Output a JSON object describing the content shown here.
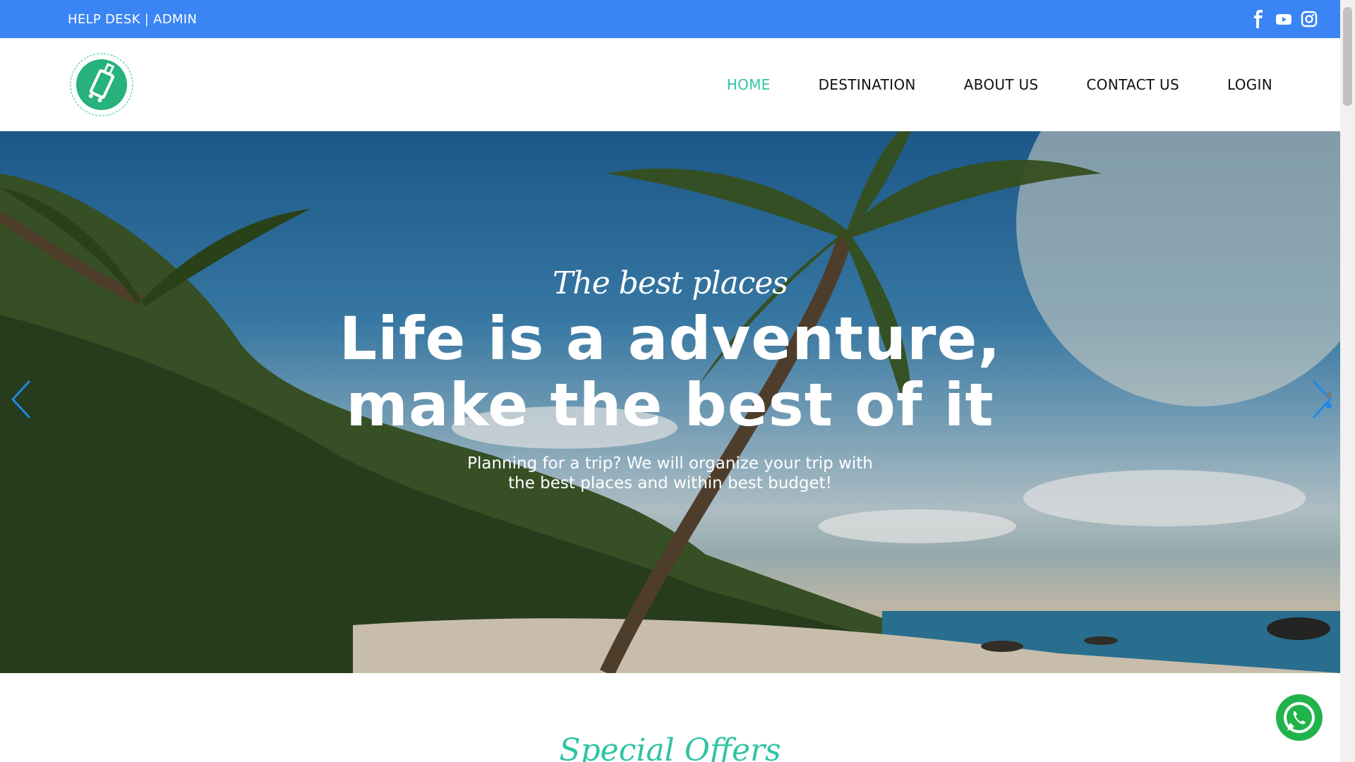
{
  "topbar": {
    "help_desk": "HELP DESK",
    "separator": "|",
    "admin": "ADMIN",
    "social_icons": [
      "facebook-icon",
      "youtube-icon",
      "instagram-icon"
    ]
  },
  "nav": {
    "items": [
      {
        "label": "HOME",
        "active": true
      },
      {
        "label": "DESTINATION",
        "active": false
      },
      {
        "label": "ABOUT US",
        "active": false
      },
      {
        "label": "CONTACT US",
        "active": false
      },
      {
        "label": "LOGIN",
        "active": false
      }
    ]
  },
  "hero": {
    "kicker": "The best places",
    "headline_line1": "Life is a adventure,",
    "headline_line2": "make the best of it",
    "sub_line1": "Planning for a trip? We will organize your trip with",
    "sub_line2": "the best places and within best budget!",
    "slide_count": 2,
    "active_slide": 2
  },
  "section": {
    "title": "Special Offers"
  },
  "colors": {
    "topbar": "#3b84f4",
    "accent": "#2ec4a5",
    "whatsapp": "#21b34b"
  }
}
